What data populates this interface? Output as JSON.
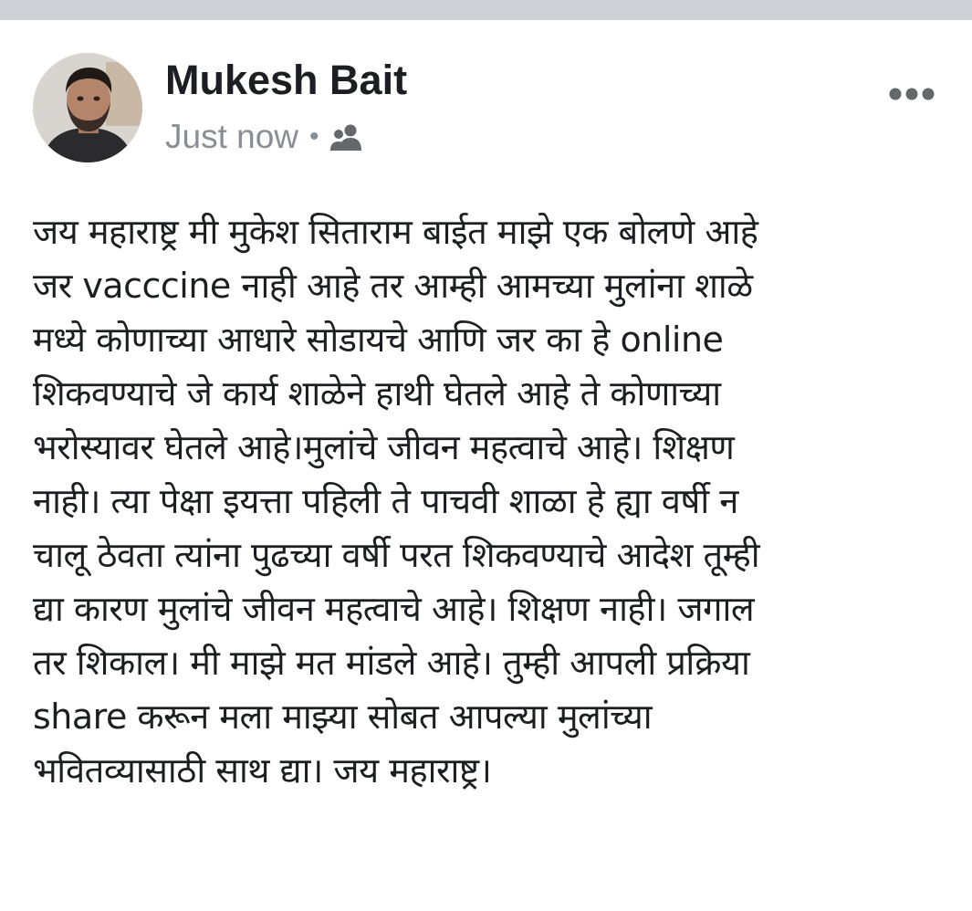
{
  "post": {
    "author_name": "Mukesh Bait",
    "timestamp": "Just now",
    "separator": "•",
    "audience_icon": "friends-icon",
    "more_icon": "more-options-icon",
    "avatar_icon": "profile-photo",
    "text": "जय महाराष्ट्र मी मुकेश सिताराम बाईत माझे एक बोलणे आहे\nजर vacccine नाही आहे तर आम्ही आमच्या मुलांना शाळे\nमध्ये कोणाच्या आधारे सोडायचे आणि जर का हे online\nशिकवण्याचे जे कार्य शाळेने हाथी घेतले आहे ते कोणाच्या\nभरोस्यावर घेतले आहे।मुलांचे जीवन महत्वाचे आहे। शिक्षण\nनाही। त्या पेक्षा इयत्ता पहिली ते पाचवी शाळा हे ह्या वर्षी न\nचालू ठेवता त्यांना पुढच्या वर्षी परत शिकवण्याचे आदेश तूम्ही\nद्या कारण मुलांचे जीवन महत्वाचे आहे। शिक्षण नाही। जगाल\nतर शिकाल।  मी माझे मत मांडले आहे। तुम्ही आपली प्रक्रिया\nshare करून मला माझ्या सोबत आपल्या मुलांच्या\nभवितव्यासाठी साथ द्या। जय महाराष्ट्र।"
  },
  "colors": {
    "top_bar": "#cdd0d4",
    "name": "#1c1e21",
    "meta": "#8a8d91",
    "body_text": "#1c1e21",
    "icon_gray": "#65676b"
  }
}
